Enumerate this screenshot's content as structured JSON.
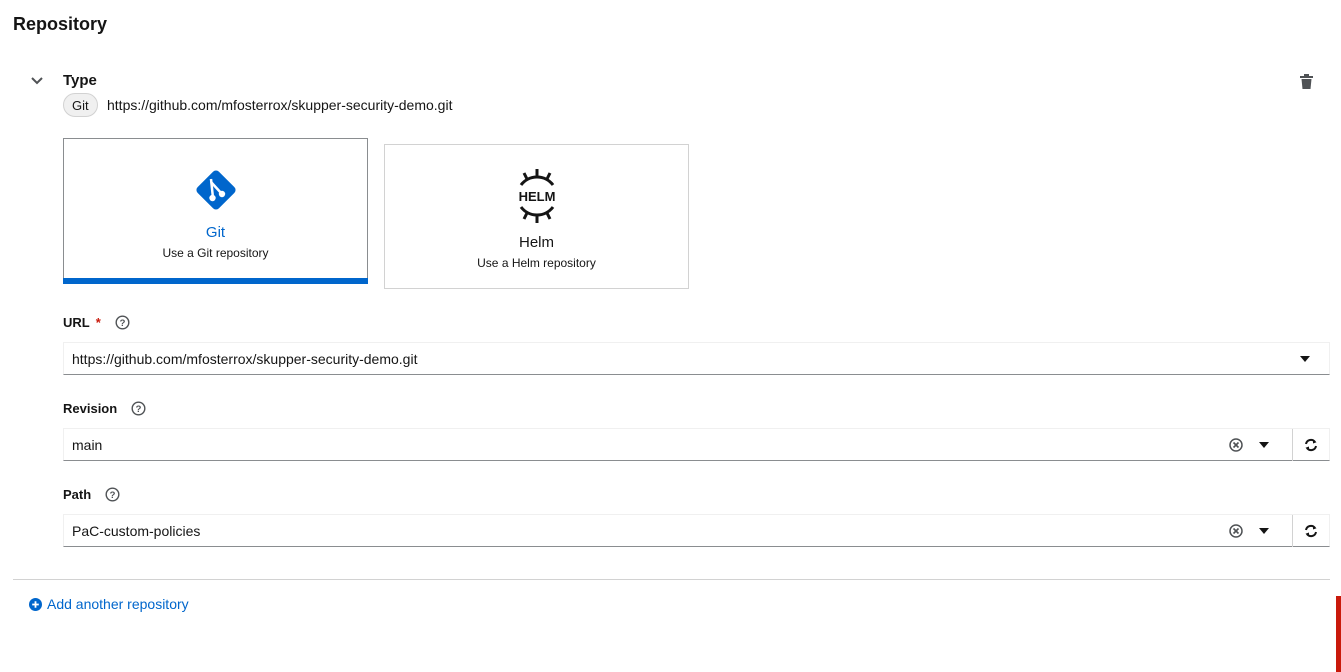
{
  "section": {
    "title": "Repository"
  },
  "type": {
    "label": "Type",
    "badge": "Git",
    "url": "https://github.com/mfosterrox/skupper-security-demo.git"
  },
  "tiles": [
    {
      "title": "Git",
      "description": "Use a Git repository",
      "selected": true,
      "icon": "git-icon"
    },
    {
      "title": "Helm",
      "description": "Use a Helm repository",
      "selected": false,
      "icon": "helm-icon",
      "logo_text": "HELM"
    }
  ],
  "fields": {
    "url": {
      "label": "URL",
      "required_mark": "*",
      "value": "https://github.com/mfosterrox/skupper-security-demo.git"
    },
    "revision": {
      "label": "Revision",
      "value": "main"
    },
    "path": {
      "label": "Path",
      "value": "PaC-custom-policies"
    }
  },
  "add_repository": {
    "label": "Add another repository"
  },
  "colors": {
    "accent": "#0066cc",
    "required": "#c9190b",
    "border": "#d2d2d2"
  }
}
